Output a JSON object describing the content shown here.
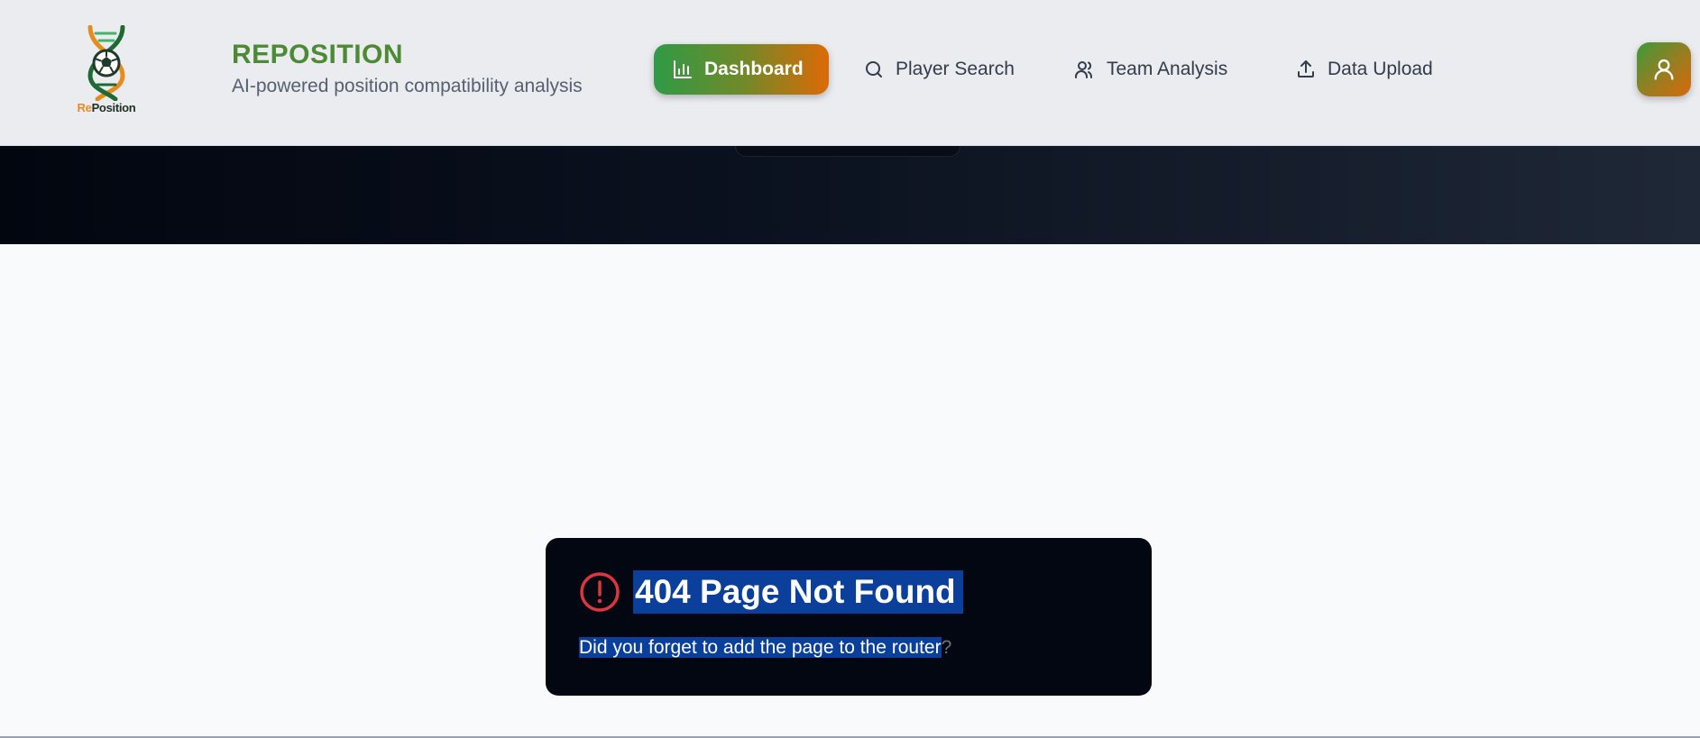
{
  "header": {
    "logo_word_prefix": "Re",
    "logo_word_suffix": "Position",
    "brand_title": "REPOSITION",
    "brand_subtitle": "AI-powered position compatibility analysis",
    "nav": {
      "dashboard": "Dashboard",
      "player_search": "Player Search",
      "team_analysis": "Team Analysis",
      "data_upload": "Data Upload"
    },
    "active_nav": "dashboard"
  },
  "error_card": {
    "title": "404 Page Not Found",
    "message_selected": "Did you forget to add the page to the router",
    "message_tail": "?"
  },
  "colors": {
    "brand_green": "#4d8a34",
    "accent_orange": "#dc6a06",
    "error_red": "#e0353b",
    "card_bg": "#030712",
    "selection": "#0a3f9c"
  },
  "icons": {
    "logo": "dna-soccer-ball-logo",
    "dashboard": "bar-chart-icon",
    "player_search": "search-icon",
    "team_analysis": "users-icon",
    "data_upload": "upload-icon",
    "avatar": "user-icon",
    "error": "alert-circle-icon"
  }
}
